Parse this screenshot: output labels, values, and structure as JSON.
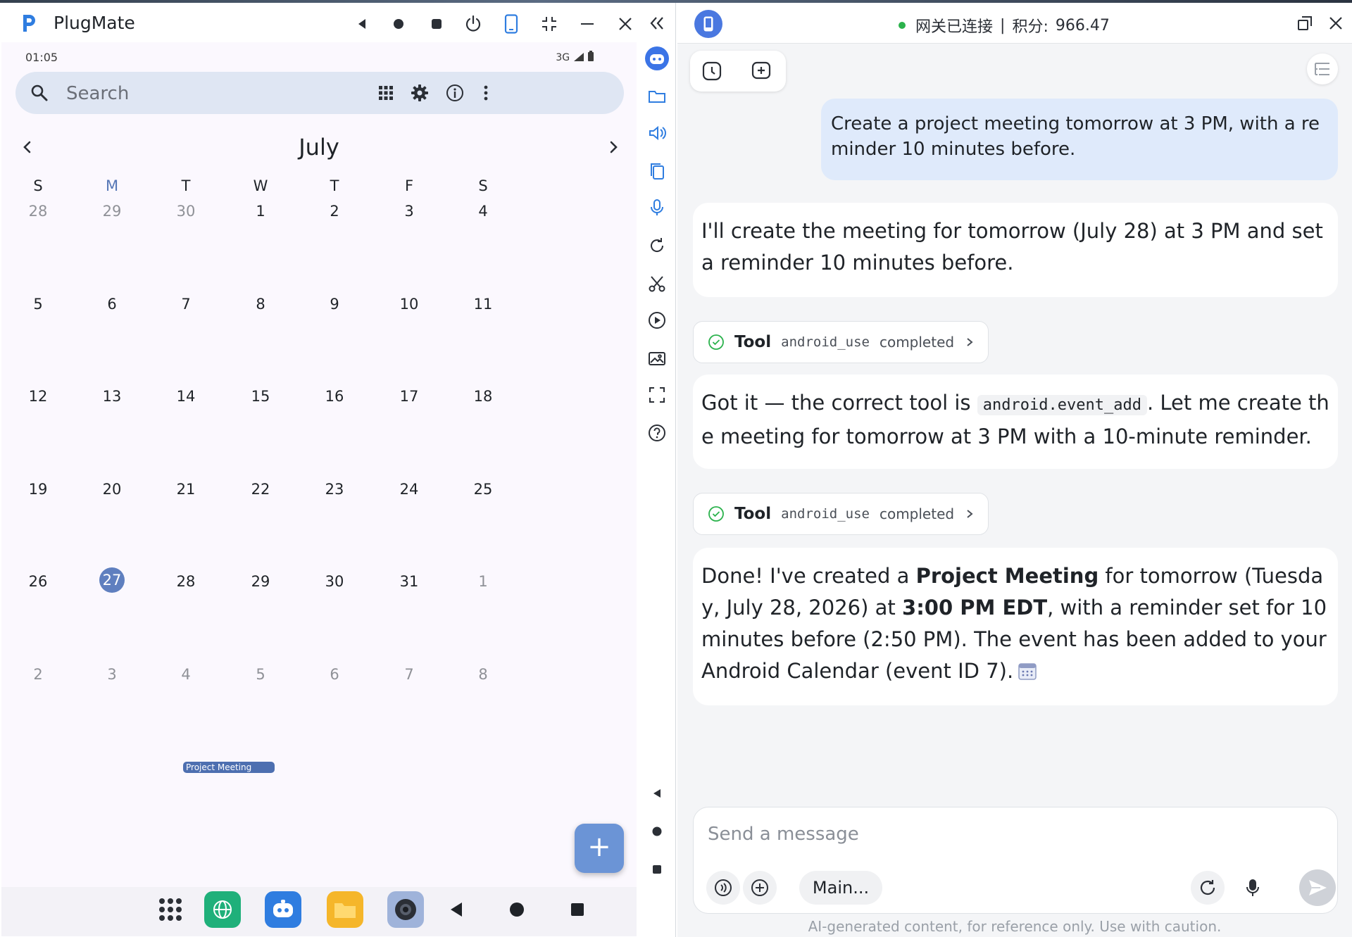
{
  "window": {
    "app_title": "PlugMate"
  },
  "phone": {
    "status_time": "01:05",
    "status_signal": "3G",
    "search_placeholder": "Search",
    "calendar": {
      "month": "July",
      "weekdays": [
        "S",
        "M",
        "T",
        "W",
        "T",
        "F",
        "S"
      ],
      "weeks": [
        [
          "28",
          "29",
          "30",
          "1",
          "2",
          "3",
          "4"
        ],
        [
          "5",
          "6",
          "7",
          "8",
          "9",
          "10",
          "11"
        ],
        [
          "12",
          "13",
          "14",
          "15",
          "16",
          "17",
          "18"
        ],
        [
          "19",
          "20",
          "21",
          "22",
          "23",
          "24",
          "25"
        ],
        [
          "26",
          "27",
          "28",
          "29",
          "30",
          "31",
          "1"
        ],
        [
          "2",
          "3",
          "4",
          "5",
          "6",
          "7",
          "8"
        ]
      ],
      "selected_day": "27",
      "event": {
        "day": "28",
        "title": "Project Meeting"
      },
      "accent": "#5f7fbf"
    },
    "fab_label": "+",
    "dock": [
      "apps-icon",
      "browser-icon",
      "assistant-icon",
      "files-icon",
      "camera-icon",
      "back-icon",
      "home-icon",
      "recents-icon"
    ]
  },
  "side_tools": [
    "collapse-icon",
    "assistant-icon",
    "folder-icon",
    "volume-icon",
    "clipboard-icon",
    "mic-icon",
    "rotate-icon",
    "scissors-icon",
    "record-icon",
    "gallery-icon",
    "fullscreen-icon",
    "help-icon",
    "back-icon",
    "home-icon",
    "recents-icon"
  ],
  "chat": {
    "status_text": "网关已连接",
    "separator": "|",
    "points_label": "积分:",
    "points_value": "966.47",
    "status_color": "#2bb24c",
    "messages": {
      "user_1": "Create a project meeting tomorrow at 3 PM, with a reminder 10 minutes before.",
      "assistant_1": "I'll create the meeting for tomorrow (July 28) at 3 PM and set a reminder 10 minutes before.",
      "tool_1": {
        "word": "Tool",
        "name": "android_use",
        "state": "completed"
      },
      "assistant_2": {
        "before": "Got it — the correct tool is ",
        "code": "android.event_add",
        "after": ". Let me create the meeting for tomorrow at 3 PM with a 10-minute reminder."
      },
      "tool_2": {
        "word": "Tool",
        "name": "android_use",
        "state": "completed"
      },
      "assistant_3": {
        "p1": "Done! I've created a ",
        "b1": "Project Meeting",
        "p2": " for tomorrow (Tuesday, July 28, 2026) at ",
        "b2": "3:00 PM EDT",
        "p3": ", with a reminder set for 10 minutes before (2:50 PM). The event has been added to your Android Calendar (event ID 7)."
      }
    },
    "composer_placeholder": "Send a message",
    "model_label": "Main...",
    "disclaimer": "AI-generated content, for reference only. Use with caution."
  }
}
